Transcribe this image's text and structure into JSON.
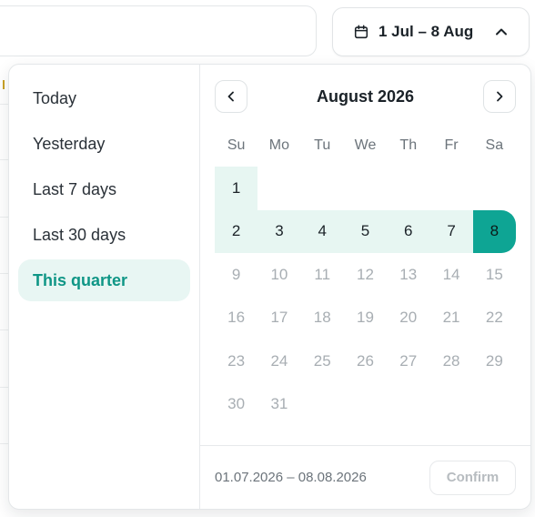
{
  "trigger": {
    "label": "1 Jul – 8 Aug"
  },
  "presets": [
    {
      "label": "Today",
      "active": false
    },
    {
      "label": "Yesterday",
      "active": false
    },
    {
      "label": "Last 7 days",
      "active": false
    },
    {
      "label": "Last 30 days",
      "active": false
    },
    {
      "label": "This quarter",
      "active": true
    }
  ],
  "calendar": {
    "month_title": "August 2026",
    "weekdays": [
      "Su",
      "Mo",
      "Tu",
      "We",
      "Th",
      "Fr",
      "Sa"
    ],
    "weeks": [
      [
        {
          "d": "1",
          "state": "in-range"
        },
        {
          "d": "",
          "state": "blank"
        },
        {
          "d": "",
          "state": "blank"
        },
        {
          "d": "",
          "state": "blank"
        },
        {
          "d": "",
          "state": "blank"
        },
        {
          "d": "",
          "state": "blank"
        },
        {
          "d": "",
          "state": "blank"
        }
      ],
      [
        {
          "d": "2",
          "state": "in-range"
        },
        {
          "d": "3",
          "state": "in-range"
        },
        {
          "d": "4",
          "state": "in-range"
        },
        {
          "d": "5",
          "state": "in-range"
        },
        {
          "d": "6",
          "state": "in-range"
        },
        {
          "d": "7",
          "state": "in-range"
        },
        {
          "d": "8",
          "state": "range-end"
        }
      ],
      [
        {
          "d": "9",
          "state": "disabled"
        },
        {
          "d": "10",
          "state": "disabled"
        },
        {
          "d": "11",
          "state": "disabled"
        },
        {
          "d": "12",
          "state": "disabled"
        },
        {
          "d": "13",
          "state": "disabled"
        },
        {
          "d": "14",
          "state": "disabled"
        },
        {
          "d": "15",
          "state": "disabled"
        }
      ],
      [
        {
          "d": "16",
          "state": "disabled"
        },
        {
          "d": "17",
          "state": "disabled"
        },
        {
          "d": "18",
          "state": "disabled"
        },
        {
          "d": "19",
          "state": "disabled"
        },
        {
          "d": "20",
          "state": "disabled"
        },
        {
          "d": "21",
          "state": "disabled"
        },
        {
          "d": "22",
          "state": "disabled"
        }
      ],
      [
        {
          "d": "23",
          "state": "disabled"
        },
        {
          "d": "24",
          "state": "disabled"
        },
        {
          "d": "25",
          "state": "disabled"
        },
        {
          "d": "26",
          "state": "disabled"
        },
        {
          "d": "27",
          "state": "disabled"
        },
        {
          "d": "28",
          "state": "disabled"
        },
        {
          "d": "29",
          "state": "disabled"
        }
      ],
      [
        {
          "d": "30",
          "state": "disabled"
        },
        {
          "d": "31",
          "state": "disabled"
        },
        {
          "d": "",
          "state": "blank"
        },
        {
          "d": "",
          "state": "blank"
        },
        {
          "d": "",
          "state": "blank"
        },
        {
          "d": "",
          "state": "blank"
        },
        {
          "d": "",
          "state": "blank"
        }
      ]
    ]
  },
  "footer": {
    "range_text": "01.07.2026 – 08.08.2026",
    "confirm_label": "Confirm"
  },
  "icons": {
    "trigger": "calendar-icon",
    "toggle": "chevron-up-icon",
    "prev": "chevron-left-icon",
    "next": "chevron-right-icon"
  },
  "colors": {
    "accent": "#0ea594",
    "range_bg": "#e7f6f2",
    "active_preset_text": "#0f9686"
  }
}
